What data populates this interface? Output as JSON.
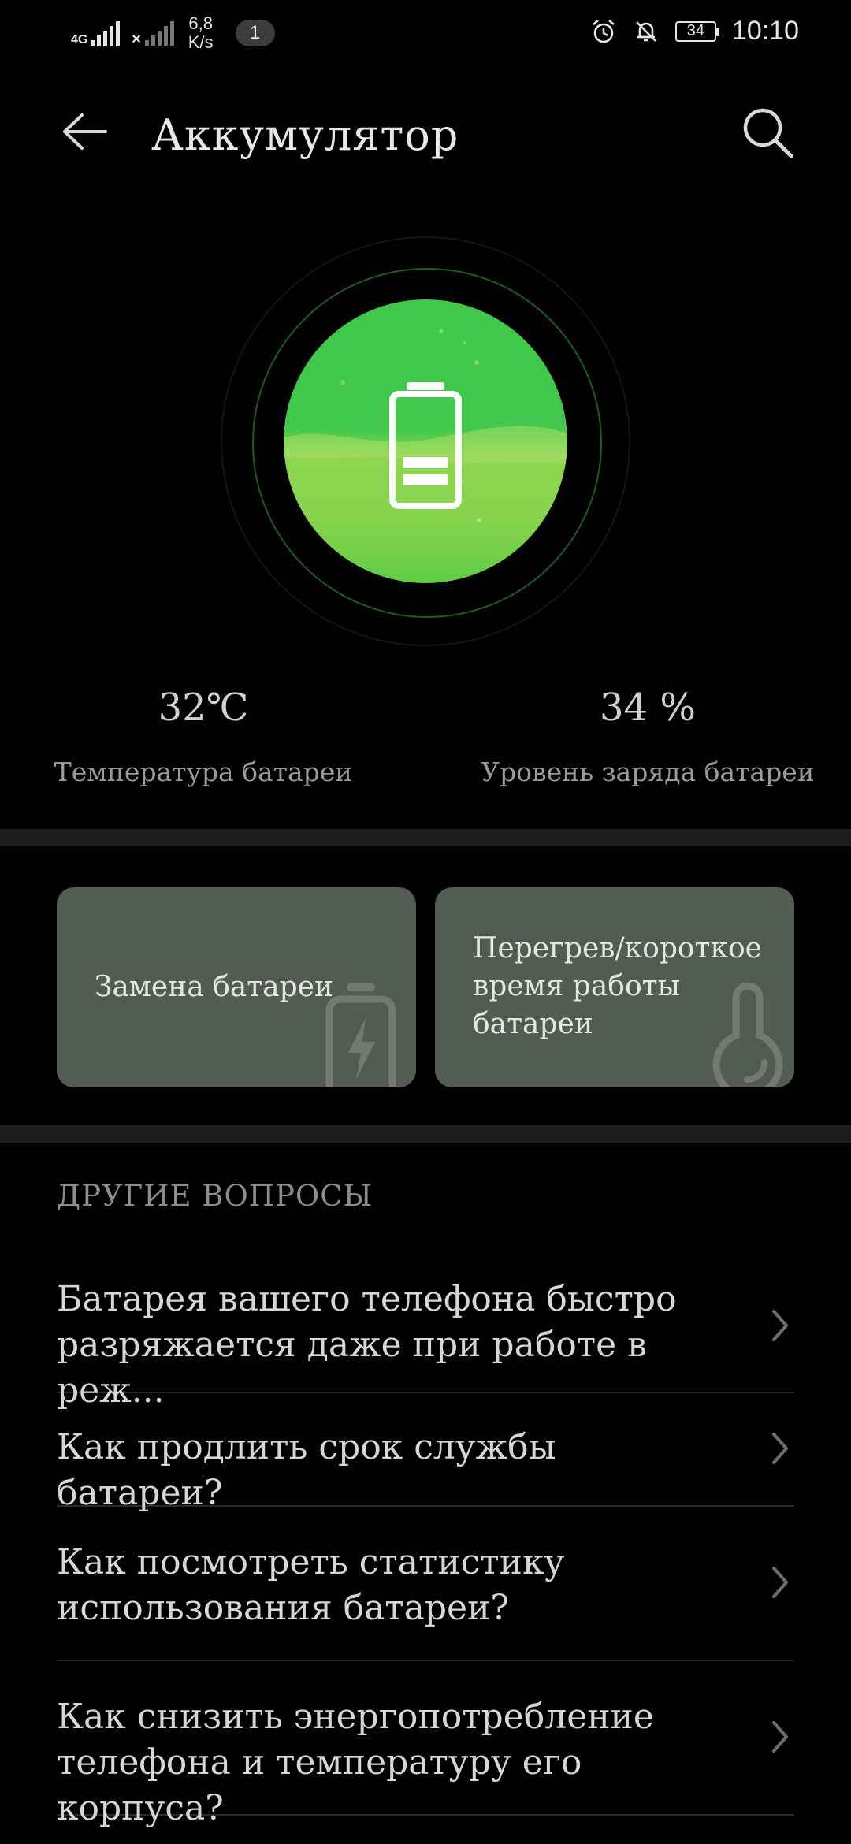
{
  "status_bar": {
    "network_tag": "4G",
    "speed_value": "6,8",
    "speed_unit": "K/s",
    "notification_count": "1",
    "battery_level": "34",
    "time": "10:10"
  },
  "app_bar": {
    "title": "Аккумулятор"
  },
  "battery": {
    "temperature_value": "32℃",
    "temperature_label": "Температура батареи",
    "charge_value": "34 %",
    "charge_label": "Уровень заряда батареи"
  },
  "cards": [
    {
      "label": "Замена батареи"
    },
    {
      "label_lines": [
        "Перегрев/короткое",
        "время работы",
        "батареи"
      ]
    }
  ],
  "other_questions": {
    "title": "ДРУГИЕ ВОПРОСЫ",
    "items": [
      {
        "lines": [
          "Батарея вашего телефона быстро",
          "разряжается даже при работе в реж..."
        ]
      },
      {
        "lines": [
          "Как продлить срок службы батареи?"
        ]
      },
      {
        "lines": [
          "Как посмотреть статистику",
          "использования батареи?"
        ]
      },
      {
        "lines": [
          "Как снизить энергопотребление",
          "телефона и температуру его корпуса?"
        ]
      }
    ]
  },
  "colors": {
    "background": "#000000",
    "accent_green": "#43c84c",
    "card_bg": "#535c53"
  }
}
